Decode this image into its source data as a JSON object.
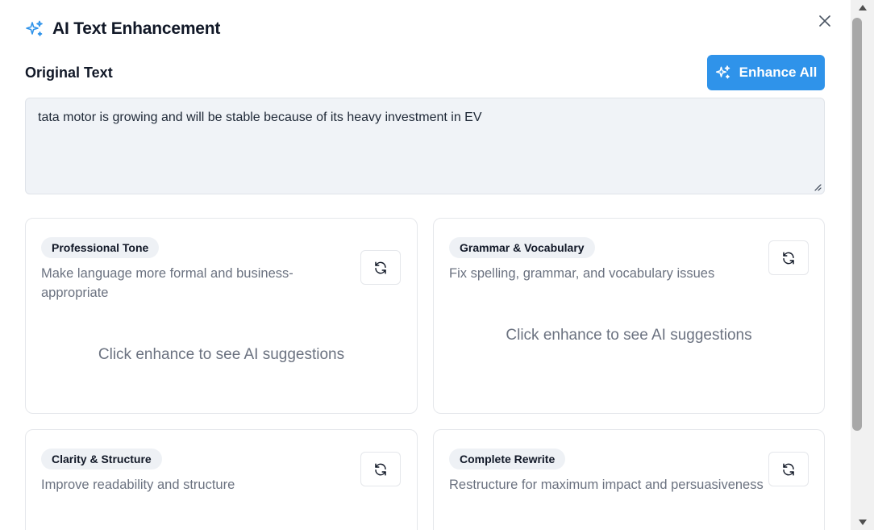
{
  "dialog": {
    "title": "AI Text Enhancement",
    "title_icon": "sparkles-icon",
    "close_icon": "close-icon"
  },
  "original": {
    "label": "Original Text",
    "value": "tata motor is growing and will be stable because of its heavy investment in EV"
  },
  "toolbar": {
    "enhance_all_label": "Enhance All",
    "enhance_all_icon": "sparkles-icon"
  },
  "cards": [
    {
      "badge": "Professional Tone",
      "description": "Make language more formal and business-appropriate",
      "description_lines": [
        "Make language more formal and business-",
        "appropriate"
      ],
      "placeholder": "Click enhance to see AI suggestions",
      "action_icon": "refresh-icon"
    },
    {
      "badge": "Grammar & Vocabulary",
      "description": "Fix spelling, grammar, and vocabulary issues",
      "placeholder": "Click enhance to see AI suggestions",
      "action_icon": "refresh-icon"
    },
    {
      "badge": "Clarity & Structure",
      "description": "Improve readability and structure",
      "action_icon": "refresh-icon"
    },
    {
      "badge": "Complete Rewrite",
      "description": "Restructure for maximum impact and persuasiveness",
      "action_icon": "refresh-icon"
    }
  ],
  "colors": {
    "accent": "#2f93ea",
    "textarea_bg": "#f0f3f7",
    "badge_bg": "#eef1f5",
    "muted_text": "#6b7280"
  }
}
